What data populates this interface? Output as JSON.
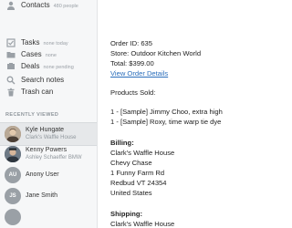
{
  "sidebar": {
    "nav": [
      {
        "label": "Contacts",
        "sub": "480 people",
        "icon": "person-icon"
      },
      {
        "label": "Tasks",
        "sub": "none today",
        "icon": "checkbox-icon"
      },
      {
        "label": "Cases",
        "sub": "none",
        "icon": "folder-icon"
      },
      {
        "label": "Deals",
        "sub": "none pending",
        "icon": "deals-icon"
      },
      {
        "label": "Search notes",
        "sub": "",
        "icon": "search-icon"
      },
      {
        "label": "Trash can",
        "sub": "",
        "icon": "trash-icon"
      }
    ],
    "recently_viewed_heading": "RECENTLY VIEWED",
    "recent": [
      {
        "name": "Kyle Hungate",
        "sub": "Clark's Waffle House",
        "initials": "",
        "color": "#8a7a6a",
        "active": "true"
      },
      {
        "name": "Kenny Powers",
        "sub": "Ashley Schaeffer BMW",
        "initials": "",
        "color": "#5a6470",
        "active": "false"
      },
      {
        "name": "Anony User",
        "sub": "",
        "initials": "AU",
        "color": "#9aa0a6",
        "active": "false"
      },
      {
        "name": "Jane Smith",
        "sub": "",
        "initials": "JS",
        "color": "#9aa0a6",
        "active": "false"
      }
    ]
  },
  "order": {
    "order_id": "Order ID: 635",
    "store": "Store: Outdoor Kitchen World",
    "total": "Total: $399.00",
    "view_link": "View Order Details",
    "products_heading": "Products Sold:",
    "products": [
      "1 - [Sample] Jimmy Choo, extra high",
      "1 - [Sample] Roxy, time warp tie dye"
    ],
    "billing_heading": "Billing:",
    "billing": [
      "Clark's Waffle House",
      "Chevy Chase",
      "1 Funny Farm Rd",
      "Redbud VT 24354",
      "United States"
    ],
    "shipping_heading": "Shipping:",
    "shipping": [
      "Clark's Waffle House"
    ]
  },
  "colors": {
    "link": "#2a6ebb",
    "sidebar_bg": "#f6f7f8"
  }
}
